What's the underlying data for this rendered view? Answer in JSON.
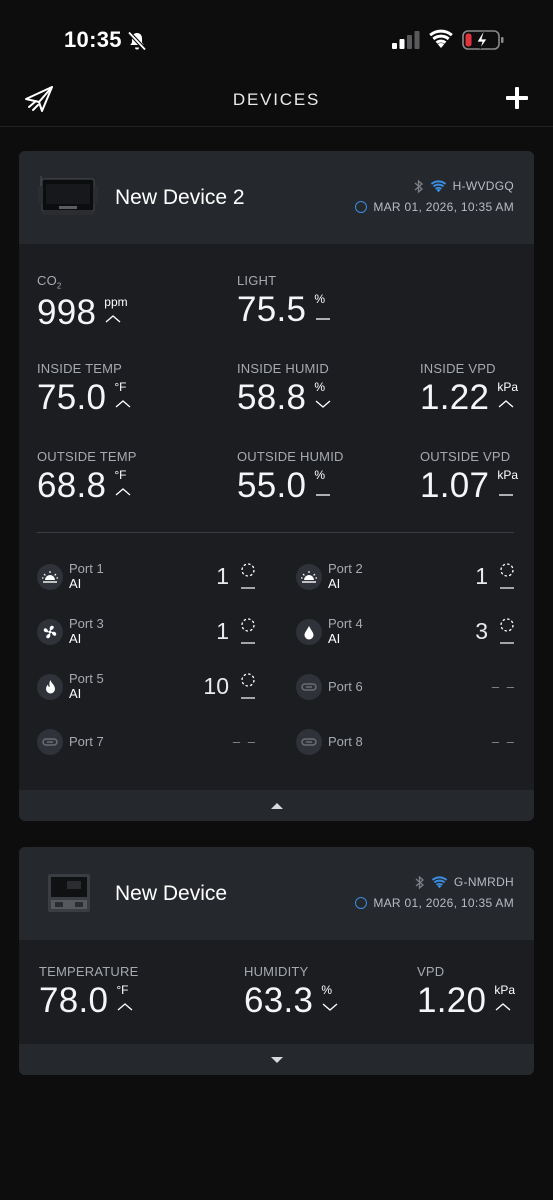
{
  "status": {
    "time": "10:35"
  },
  "nav": {
    "title": "DEVICES"
  },
  "devices": [
    {
      "name": "New Device 2",
      "code": "H-WVDGQ",
      "timestamp": "MAR 01, 2026, 10:35 AM",
      "metrics": {
        "co2": {
          "label_main": "CO",
          "label_sub": "2",
          "value": "998",
          "unit": "ppm",
          "trend": "up"
        },
        "light": {
          "label": "LIGHT",
          "value": "75.5",
          "unit": "%",
          "trend": "flat"
        },
        "inside_temp": {
          "label": "INSIDE TEMP",
          "value": "75.0",
          "unit": "°F",
          "trend": "up"
        },
        "inside_humid": {
          "label": "INSIDE HUMID",
          "value": "58.8",
          "unit": "%",
          "trend": "down"
        },
        "inside_vpd": {
          "label": "INSIDE VPD",
          "value": "1.22",
          "unit": "kPa",
          "trend": "up"
        },
        "outside_temp": {
          "label": "OUTSIDE TEMP",
          "value": "68.8",
          "unit": "°F",
          "trend": "up"
        },
        "outside_humid": {
          "label": "OUTSIDE HUMID",
          "value": "55.0",
          "unit": "%",
          "trend": "flat"
        },
        "outside_vpd": {
          "label": "OUTSIDE VPD",
          "value": "1.07",
          "unit": "kPa",
          "trend": "flat"
        }
      },
      "ports": [
        {
          "name": "Port 1",
          "mode": "AI",
          "level": "1",
          "icon": "sunrise-icon"
        },
        {
          "name": "Port 2",
          "mode": "AI",
          "level": "1",
          "icon": "sunrise-icon"
        },
        {
          "name": "Port 3",
          "mode": "AI",
          "level": "1",
          "icon": "fan-icon"
        },
        {
          "name": "Port 4",
          "mode": "AI",
          "level": "3",
          "icon": "water-drop-icon"
        },
        {
          "name": "Port 5",
          "mode": "AI",
          "level": "10",
          "icon": "flame-icon"
        },
        {
          "name": "Port 6",
          "mode": "",
          "level": "– –",
          "icon": "link-icon"
        },
        {
          "name": "Port 7",
          "mode": "",
          "level": "– –",
          "icon": "link-icon"
        },
        {
          "name": "Port 8",
          "mode": "",
          "level": "– –",
          "icon": "link-icon"
        }
      ]
    },
    {
      "name": "New Device",
      "code": "G-NMRDH",
      "timestamp": "MAR 01, 2026, 10:35 AM",
      "metrics": {
        "temperature": {
          "label": "TEMPERATURE",
          "value": "78.0",
          "unit": "°F",
          "trend": "up"
        },
        "humidity": {
          "label": "HUMIDITY",
          "value": "63.3",
          "unit": "%",
          "trend": "down"
        },
        "vpd": {
          "label": "VPD",
          "value": "1.20",
          "unit": "kPa",
          "trend": "up"
        }
      }
    }
  ],
  "colors": {
    "accent": "#3b8de0",
    "battery_low": "#e0333a"
  }
}
